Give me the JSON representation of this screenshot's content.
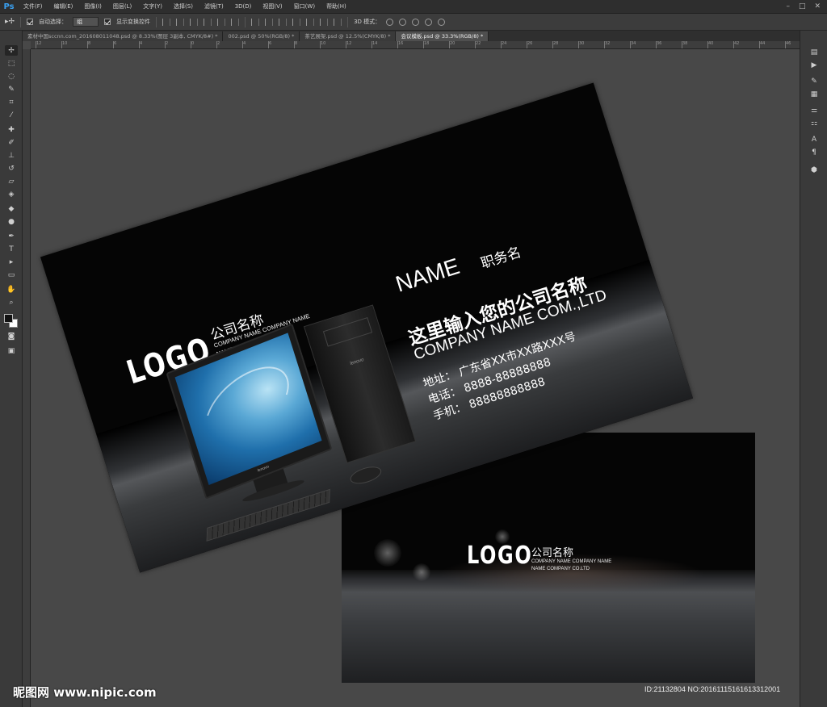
{
  "app": {
    "logo": "Ps"
  },
  "menu": [
    "文件(F)",
    "编辑(E)",
    "图像(I)",
    "图层(L)",
    "文字(Y)",
    "选择(S)",
    "滤镜(T)",
    "3D(D)",
    "视图(V)",
    "窗口(W)",
    "帮助(H)"
  ],
  "window_controls": {
    "minimize": "–",
    "maximize": "□",
    "close": "✕"
  },
  "options": {
    "auto_select_label": "自动选择：",
    "auto_select_value": "组",
    "show_transform_label": "显示变换控件",
    "mode3d_label": "3D 模式："
  },
  "tabs": [
    {
      "label": "素材中国sccnn.com_2016080110​48.psd @ 8.33%(图层 3副本, CMYK/8#) *",
      "active": false
    },
    {
      "label": "002.psd @ 50%(RGB/8) *",
      "active": false
    },
    {
      "label": "茶艺展架.psd @ 12.5%(CMYK/8) *",
      "active": false
    },
    {
      "label": "会议模板.psd @ 33.3%(RGB/8) *",
      "active": true
    }
  ],
  "ruler_numbers": [
    "12",
    "10",
    "8",
    "6",
    "4",
    "2",
    "0",
    "2",
    "4",
    "6",
    "8",
    "10",
    "12",
    "14",
    "16",
    "18",
    "20",
    "22",
    "24",
    "26",
    "28",
    "30",
    "32",
    "34",
    "36",
    "38",
    "40",
    "42",
    "44",
    "46"
  ],
  "card_front": {
    "logo": "LOGO",
    "company_cn": "公司名称",
    "company_en_1": "COMPANY NAME COMPANY NAME",
    "company_en_2": "NAME COMPANY CO.LTD",
    "name": "NAME",
    "title": "职务名",
    "company_full_cn": "这里输入您的公司名称",
    "company_full_en": "COMPANY NAME COM.,LTD",
    "address": "地址： 广东省XX市XX路XXX号",
    "phone": "电话： 8888-88888888",
    "mobile": "手机： 88888888888",
    "monitor_brand": "lenovo",
    "tower_brand": "lenovo"
  },
  "card_back": {
    "logo": "LOGO",
    "company_cn": "公司名称",
    "company_en_1": "COMPANY NAME COMPANY NAME",
    "company_en_2": "NAME COMPANY CO.LTD"
  },
  "watermark": {
    "left": "昵图网 www.nipic.com",
    "right": "ID:21132804 NO:20161115161613312001"
  }
}
